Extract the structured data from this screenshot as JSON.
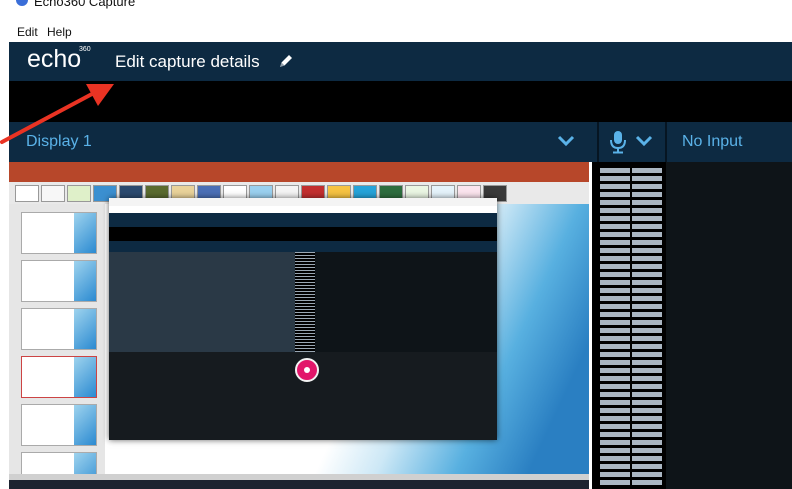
{
  "window": {
    "title": "Echo360 Capture"
  },
  "menu": {
    "items": [
      "Edit",
      "Help"
    ]
  },
  "header": {
    "logo": "echo",
    "logo_sup": "360",
    "title": "Edit capture details"
  },
  "source_bar": {
    "display_label": "Display 1",
    "input_label": "No Input"
  },
  "colors": {
    "header_bg": "#0d2a42",
    "accent": "#5ab2e8",
    "record": "#e2166a",
    "arrow": "#ea3323"
  }
}
